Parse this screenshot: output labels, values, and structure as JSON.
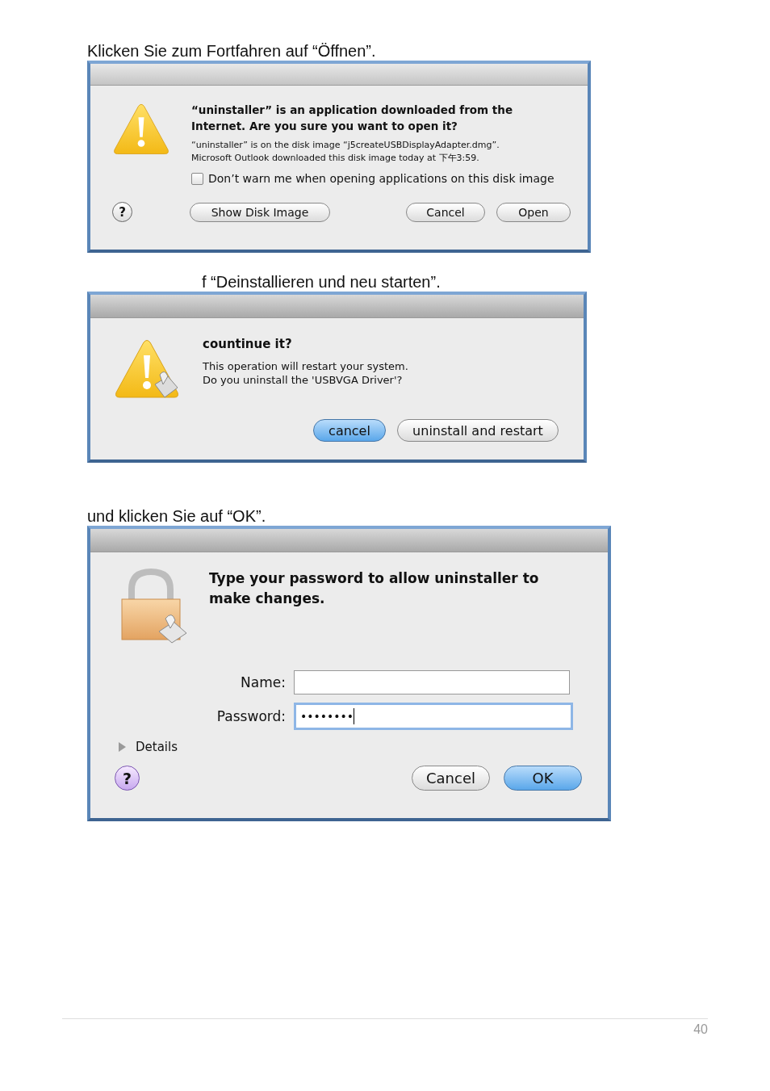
{
  "sections": [
    {
      "caption": "Klicken Sie zum Fortfahren auf “Öffnen”.",
      "dialog": {
        "kind": "open_warning",
        "heading": "“uninstaller” is an application downloaded from the Internet. Are you sure you want to open it?",
        "message": [
          "“uninstaller” is on the disk image “j5createUSBDisplayAdapter.dmg”.",
          "Microsoft Outlook downloaded this disk image today at 下午3:59."
        ],
        "checkbox": {
          "label": "Don’t warn me when opening applications on this disk image",
          "checked": false
        },
        "help_button": "?",
        "buttons": [
          {
            "label": "Show Disk Image",
            "default": false
          },
          {
            "label": "Cancel",
            "default": false
          },
          {
            "label": "Open",
            "default": false
          }
        ]
      }
    },
    {
      "caption": "f “Deinstallieren und neu starten”.",
      "dialog": {
        "kind": "uninstall_confirm",
        "heading": "countinue it?",
        "message": [
          "This operation will restart your system.",
          "Do you uninstall the 'USBVGA Driver'?"
        ],
        "buttons": [
          {
            "label": "cancel",
            "default": true
          },
          {
            "label": "uninstall and restart",
            "default": false
          }
        ]
      }
    },
    {
      "caption": "und klicken Sie auf “OK”.",
      "dialog": {
        "kind": "password",
        "heading": "Type your password to allow uninstaller to make changes.",
        "fields": [
          {
            "label": "Name:",
            "focused": false
          },
          {
            "label": "Password:",
            "value": "••••••••",
            "focused": true
          }
        ],
        "details": {
          "label": "Details",
          "expanded": false
        },
        "help_button": "?",
        "buttons": [
          {
            "label": "Cancel",
            "default": false
          },
          {
            "label": "OK",
            "default": true
          }
        ]
      }
    }
  ],
  "footer": {
    "page_number": "40"
  }
}
